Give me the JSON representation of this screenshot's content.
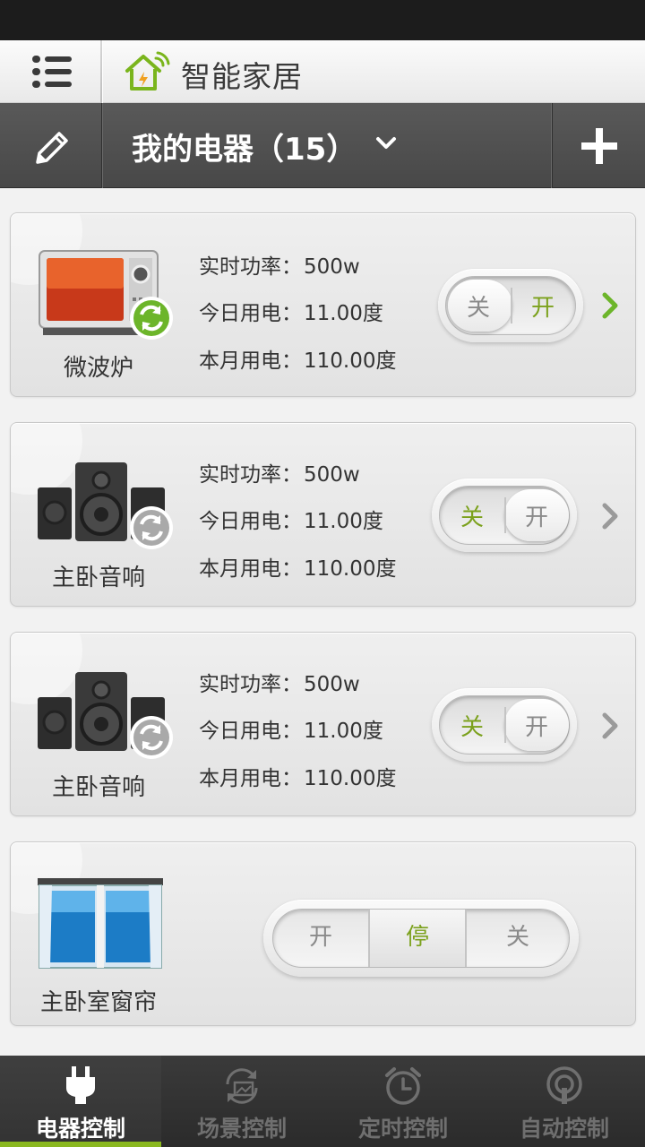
{
  "app": {
    "title": "智能家居"
  },
  "toolbar": {
    "title": "我的电器（15）"
  },
  "colors": {
    "accent": "#8ab81f",
    "active_text": "#7ba11c"
  },
  "devices": [
    {
      "name": "微波炉",
      "power_label": "实时功率：",
      "power": "500w",
      "today_label": "今日用电：",
      "today": "11.00度",
      "month_label": "本月用电：",
      "month": "110.00度",
      "toggle_off": "关",
      "toggle_on": "开",
      "state": "on",
      "sync_icon": "sync-icon-green"
    },
    {
      "name": "主卧音响",
      "power_label": "实时功率：",
      "power": "500w",
      "today_label": "今日用电：",
      "today": "11.00度",
      "month_label": "本月用电：",
      "month": "110.00度",
      "toggle_off": "关",
      "toggle_on": "开",
      "state": "off",
      "sync_icon": "sync-icon-gray"
    },
    {
      "name": "主卧音响",
      "power_label": "实时功率：",
      "power": "500w",
      "today_label": "今日用电：",
      "today": "11.00度",
      "month_label": "本月用电：",
      "month": "110.00度",
      "toggle_off": "关",
      "toggle_on": "开",
      "state": "off",
      "sync_icon": "sync-icon-gray"
    }
  ],
  "curtain": {
    "name": "主卧室窗帘",
    "open": "开",
    "stop": "停",
    "close": "关",
    "state": "stop"
  },
  "tabs": [
    {
      "label": "电器控制",
      "icon": "plug-icon",
      "active": true
    },
    {
      "label": "场景控制",
      "icon": "scene-icon",
      "active": false
    },
    {
      "label": "定时控制",
      "icon": "alarm-clock-icon",
      "active": false
    },
    {
      "label": "自动控制",
      "icon": "auto-icon",
      "active": false
    }
  ]
}
